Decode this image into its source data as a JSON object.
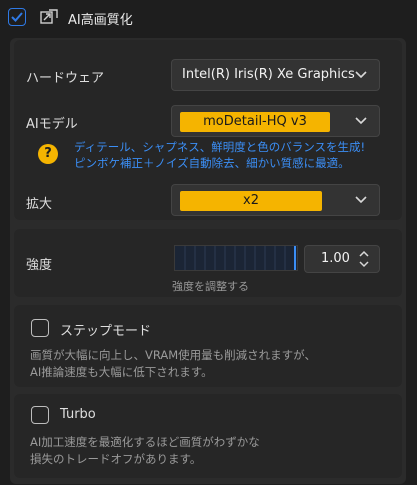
{
  "header": {
    "title": "AI高画質化",
    "enabled": true
  },
  "hardware": {
    "label": "ハードウェア",
    "value": "Intel(R) Iris(R) Xe Graphics"
  },
  "ai_model": {
    "label": "AIモデル",
    "value": "moDetail-HQ  v3",
    "hint_line1": "ディテール、シャプネス、鮮明度と色のバランスを生成!",
    "hint_line2": "ピンボケ補正＋ノイズ自動除去、細かい質感に最適。"
  },
  "scale": {
    "label": "拡大",
    "value": "x2"
  },
  "strength": {
    "label": "強度",
    "value": "1.00",
    "fraction": 1.0,
    "sublabel": "強度を調整する"
  },
  "step_mode": {
    "label": "ステップモード",
    "checked": false,
    "desc_line1": "画質が大幅に向上し、VRAM使用量も削減されますが、",
    "desc_line2": "AI推論速度も大幅に低下されます。"
  },
  "turbo": {
    "label": "Turbo",
    "checked": false,
    "desc_line1": "AI加工速度を最適化するほど画質がわずかな",
    "desc_line2": "損失のトレードオフがあります。"
  },
  "colors": {
    "accent": "#3b8ef5",
    "pill": "#f5b400",
    "check_border": "#2f7ae5"
  }
}
